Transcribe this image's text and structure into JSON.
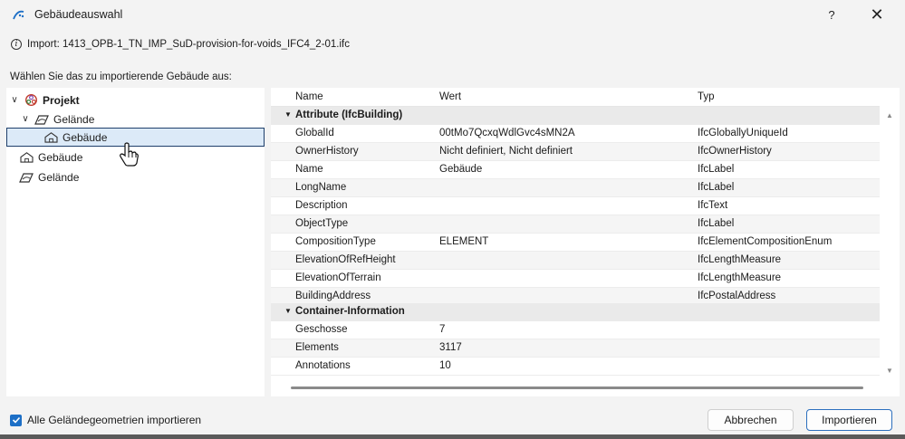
{
  "window": {
    "title": "Gebäudeauswahl",
    "help_label": "?",
    "close_label": "✕"
  },
  "info": {
    "text": "Import: 1413_OPB-1_TN_IMP_SuD-provision-for-voids_IFC4_2-01.ifc"
  },
  "prompt": "Wählen Sie das zu importierende Gebäude aus:",
  "tree": [
    {
      "label": "Projekt",
      "icon": "project-icon",
      "expanded": true
    },
    {
      "label": "Gelände",
      "icon": "terrain-icon",
      "expanded": true
    },
    {
      "label": "Gebäude",
      "icon": "building-icon",
      "selected": true
    },
    {
      "label": "Gebäude",
      "icon": "building-icon"
    },
    {
      "label": "Gelände",
      "icon": "terrain-icon"
    }
  ],
  "grid": {
    "headers": [
      "Name",
      "Wert",
      "Typ"
    ],
    "groups": [
      {
        "label": "Attribute (IfcBuilding)",
        "rows": [
          [
            "GlobalId",
            "00tMo7QcxqWdlGvc4sMN2A",
            "IfcGloballyUniqueId"
          ],
          [
            "OwnerHistory",
            "Nicht definiert, Nicht definiert",
            "IfcOwnerHistory"
          ],
          [
            "Name",
            "Gebäude",
            "IfcLabel"
          ],
          [
            "LongName",
            "",
            "IfcLabel"
          ],
          [
            "Description",
            "",
            "IfcText"
          ],
          [
            "ObjectType",
            "",
            "IfcLabel"
          ],
          [
            "CompositionType",
            "ELEMENT",
            "IfcElementCompositionEnum"
          ],
          [
            "ElevationOfRefHeight",
            "",
            "IfcLengthMeasure"
          ],
          [
            "ElevationOfTerrain",
            "",
            "IfcLengthMeasure"
          ],
          [
            "BuildingAddress",
            "",
            "IfcPostalAddress"
          ]
        ]
      },
      {
        "label": "Container-Information",
        "rows": [
          [
            "Geschosse",
            "7",
            ""
          ],
          [
            "Elements",
            "3117",
            ""
          ],
          [
            "Annotations",
            "10",
            ""
          ]
        ]
      }
    ]
  },
  "footer": {
    "checkbox_label": "Alle Geländegeometrien importieren",
    "checkbox_checked": true,
    "cancel_label": "Abbrechen",
    "import_label": "Importieren"
  },
  "colors": {
    "accent": "#1d6fc6",
    "selection_bg": "#dceaf8",
    "project_icon": "#c0392b"
  }
}
